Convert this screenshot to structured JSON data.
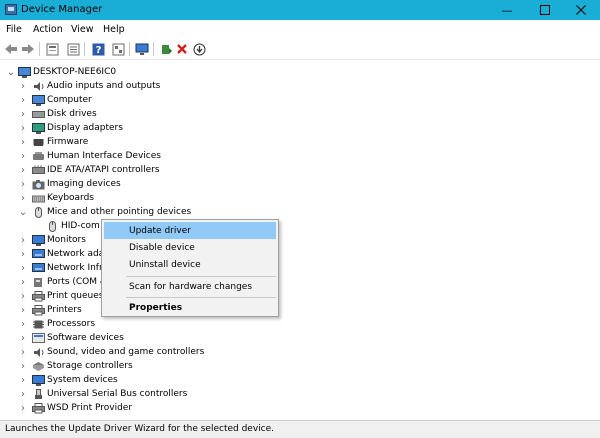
{
  "window": {
    "title": "Device Manager"
  },
  "menu": {
    "file": "File",
    "action": "Action",
    "view": "View",
    "help": "Help"
  },
  "toolbar_icons": [
    "back-icon",
    "forward-icon",
    "properties-icon",
    "show-hidden-icon",
    "help-icon",
    "action-icon",
    "monitor-icon",
    "update-driver-icon",
    "uninstall-icon",
    "scan-icon"
  ],
  "tree": {
    "root": "DESKTOP-NEE6IC0",
    "items": [
      "Audio inputs and outputs",
      "Computer",
      "Disk drives",
      "Display adapters",
      "Firmware",
      "Human Interface Devices",
      "IDE ATA/ATAPI controllers",
      "Imaging devices",
      "Keyboards",
      "Mice and other pointing devices",
      "HID-com",
      "Monitors",
      "Network adap",
      "Network Infra",
      "Ports (COM &",
      "Print queues",
      "Printers",
      "Processors",
      "Software devices",
      "Sound, video and game controllers",
      "Storage controllers",
      "System devices",
      "Universal Serial Bus controllers",
      "WSD Print Provider"
    ]
  },
  "context_menu": {
    "update_driver": "Update driver",
    "disable_device": "Disable device",
    "uninstall_device": "Uninstall device",
    "scan_hardware": "Scan for hardware changes",
    "properties": "Properties"
  },
  "status": {
    "text": "Launches the Update Driver Wizard for the selected device."
  },
  "colors": {
    "titlebar": "#1aaed6",
    "highlight": "#91c9f7"
  }
}
